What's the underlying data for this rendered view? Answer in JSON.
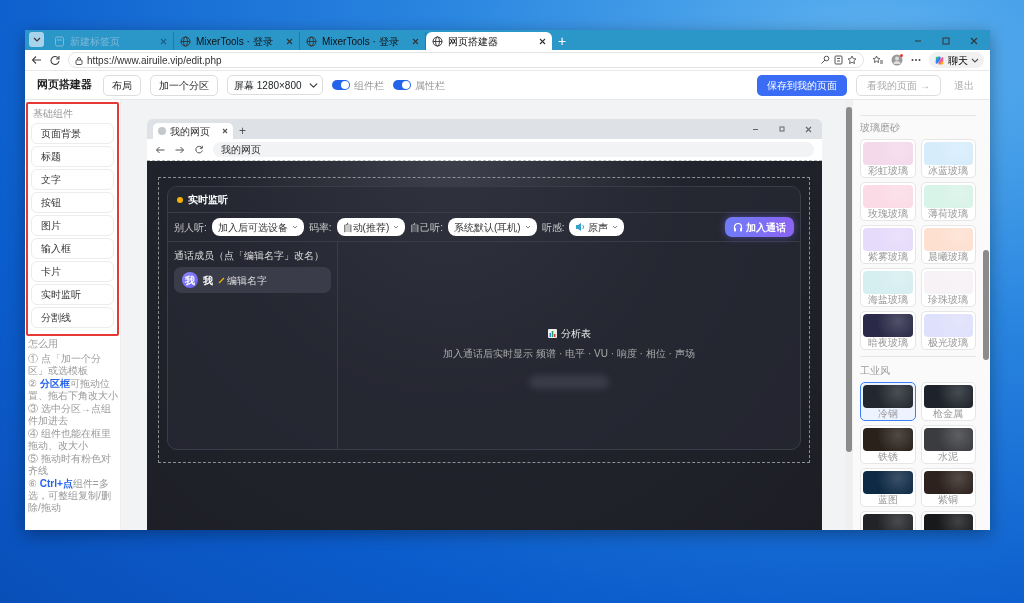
{
  "browser": {
    "tabs": [
      {
        "title": "新建标签页",
        "kind": "newtab",
        "selected": false
      },
      {
        "title": "MixerTools · 登录",
        "kind": "site",
        "selected": false
      },
      {
        "title": "MixerTools · 登录",
        "kind": "site",
        "selected": false
      },
      {
        "title": "网页搭建器",
        "kind": "site",
        "selected": true
      }
    ],
    "new_tab": "+",
    "address": "https://www.airuile.vip/edit.php",
    "copilot": "聊天"
  },
  "toolbar": {
    "title": "网页搭建器",
    "buttons": [
      "布局",
      "加一个分区"
    ],
    "screen_select": "屏幕 1280×800",
    "toggles": [
      {
        "label": "组件栏",
        "on": true
      },
      {
        "label": "属性栏",
        "on": true
      }
    ],
    "save": "保存到我的页面",
    "view": "看我的页面 →",
    "logout": "退出"
  },
  "sidebar": {
    "heading": "基础组件",
    "components": [
      "页面背景",
      "标题",
      "文字",
      "按钮",
      "图片",
      "输入框",
      "卡片",
      "实时监听",
      "分割线"
    ],
    "help_heading": "怎么用",
    "steps": [
      "① 点「加一个分区」或选模板",
      "② **分区框**可拖动位置、拖右下角改大小",
      "③ 选中分区→点组件加进去",
      "④ 组件也能在框里拖动、改大小",
      "⑤ 拖动时有粉色对齐线",
      "⑥ **Ctrl+点**组件=多选，可整组复制/删除/拖动"
    ]
  },
  "preview": {
    "tab": "我的网页",
    "new_tab": "+",
    "address": "我的网页",
    "card": {
      "title": "实时监听",
      "controls": [
        {
          "label": "别人听:",
          "value": "加入后可选设备",
          "kind": "plain"
        },
        {
          "label": "码率:",
          "value": "自动(推荐)",
          "kind": "plain"
        },
        {
          "label": "自己听:",
          "value": "系统默认(耳机)",
          "kind": "plain"
        },
        {
          "label": "听感:",
          "value": "原声",
          "kind": "sound"
        }
      ],
      "join": "加入通话",
      "members_label": "通话成员（点「编辑名字」改名）",
      "members": [
        {
          "avatar": "我",
          "name": "我",
          "edit": "编辑名字"
        }
      ],
      "analysis_title": "分析表",
      "analysis_hint": "加入通话后实时显示 频谱 · 电平 · VU · 响度 · 相位 · 声场"
    }
  },
  "themes": {
    "sections": [
      {
        "title": "玻璃磨砂",
        "items": [
          {
            "label": "彩虹玻璃",
            "color": "#f3d9ea",
            "selected": false
          },
          {
            "label": "冰蓝玻璃",
            "color": "#d6ecfb",
            "selected": false
          },
          {
            "label": "玫瑰玻璃",
            "color": "#fbdbe6",
            "selected": false
          },
          {
            "label": "薄荷玻璃",
            "color": "#d8f3e8",
            "selected": false
          },
          {
            "label": "紫雾玻璃",
            "color": "#e6dbfb",
            "selected": false
          },
          {
            "label": "晨曦玻璃",
            "color": "#fde0d0",
            "selected": false
          },
          {
            "label": "海盐玻璃",
            "color": "#d5eef0",
            "selected": false
          },
          {
            "label": "珍珠玻璃",
            "color": "#f6f2f6",
            "selected": false
          },
          {
            "label": "暗夜玻璃",
            "color": "#2a2a48",
            "selected": false
          },
          {
            "label": "极光玻璃",
            "color": "#dfe0fb",
            "selected": false
          }
        ]
      },
      {
        "title": "工业风",
        "items": [
          {
            "label": "冷钢",
            "color": "#23272f",
            "selected": true
          },
          {
            "label": "枪金属",
            "color": "#1e232b",
            "selected": false
          },
          {
            "label": "铁锈",
            "color": "#2a211b",
            "selected": false
          },
          {
            "label": "水泥",
            "color": "#3a3c40",
            "selected": false
          },
          {
            "label": "蓝图",
            "color": "#0f2a45",
            "selected": false
          },
          {
            "label": "紫铜",
            "color": "#2d221d",
            "selected": false
          },
          {
            "color": "#222326",
            "selected": false
          },
          {
            "color": "#18191b",
            "selected": false
          }
        ]
      }
    ]
  }
}
